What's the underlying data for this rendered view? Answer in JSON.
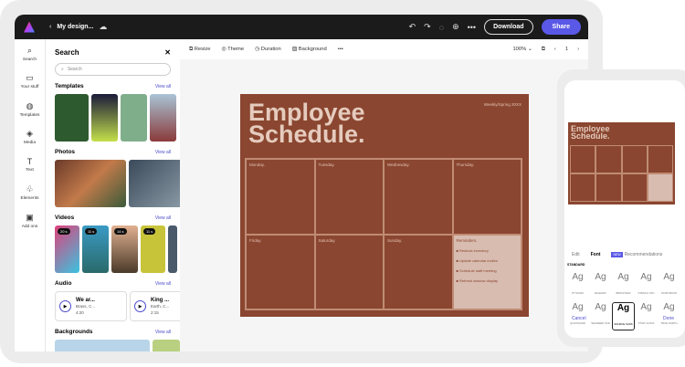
{
  "topbar": {
    "title": "My design...",
    "download": "Download",
    "share": "Share"
  },
  "rail": [
    {
      "icon": "⌕",
      "label": "Search"
    },
    {
      "icon": "▭",
      "label": "Your stuff"
    },
    {
      "icon": "◍",
      "label": "Templates"
    },
    {
      "icon": "◈",
      "label": "Media"
    },
    {
      "icon": "T",
      "label": "Text"
    },
    {
      "icon": "♧",
      "label": "Elements"
    },
    {
      "icon": "▣",
      "label": "Add ons"
    }
  ],
  "panel": {
    "title": "Search",
    "search_placeholder": "Search",
    "view_all": "View all",
    "sections": {
      "templates": "Templates",
      "photos": "Photos",
      "videos": "Videos",
      "audio": "Audio",
      "backgrounds": "Backgrounds"
    },
    "videos": [
      "20 s",
      "11 s",
      "14 s",
      "11 s"
    ],
    "audio": [
      {
        "title": "We ar...",
        "artist": "Brass, C...",
        "duration": "4:20"
      },
      {
        "title": "King ...",
        "artist": "Earth, C...",
        "duration": "2:15"
      }
    ]
  },
  "toolbar": {
    "resize": "Resize",
    "theme": "Theme",
    "duration": "Duration",
    "background": "Background",
    "more": "•••",
    "zoom": "100%",
    "page": "1"
  },
  "design": {
    "title1": "Employee",
    "title2": "Schedule.",
    "subtitle": "Weekly/Spring 20XX",
    "days": [
      "Monday.",
      "Tuesday.",
      "Wednesday.",
      "Thursday.",
      "Friday.",
      "Saturday.",
      "Sunday."
    ],
    "reminders_title": "Reminders.",
    "reminders": [
      "Restock inventory",
      "Update calendar invites",
      "Schedule staff meeting",
      "Refresh window display"
    ]
  },
  "phone": {
    "tab_edit": "Edit",
    "tab_font": "Font",
    "new_badge": "NEW",
    "tab_recommendations": "Recommendations",
    "standard": "STANDARD",
    "fonts": [
      "PT MONO",
      "RALEWAY",
      "BRINSTAND",
      "STENCIL STD",
      "STORYBOOK",
      "QUICKSAND",
      "SEAWEED SCR",
      "SOURCE SANS",
      "STINT ULTRA",
      "TRUE NORTH"
    ],
    "sample": "Ag",
    "cancel": "Cancel",
    "done": "Done"
  }
}
